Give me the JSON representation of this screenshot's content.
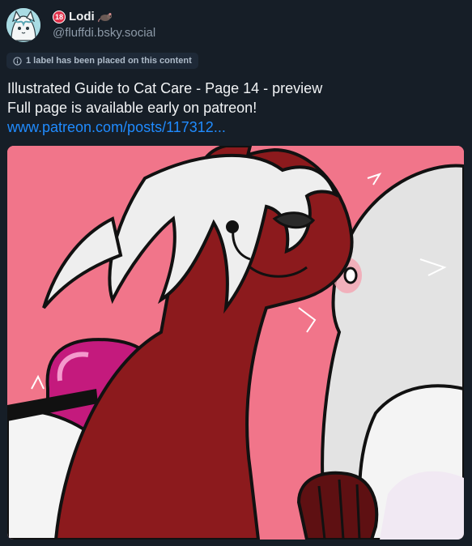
{
  "author": {
    "display_name": "Lodi",
    "handle": "@fluffdi.bsky.social",
    "badge_text": "18",
    "name_emoji_icon": "rat-icon",
    "avatar_icon": "cat-character-avatar"
  },
  "moderation": {
    "label_text": "1 label has been placed on this content",
    "icon": "info-circle-icon"
  },
  "post": {
    "lines": [
      "Illustrated Guide to Cat Care - Page 14 - preview",
      "Full page is available early on patreon!"
    ],
    "link_text": "www.patreon.com/posts/117312..."
  },
  "colors": {
    "background": "#161e27",
    "link": "#208bfe",
    "muted_text": "#8d9aa8",
    "pill_background": "#1e2937",
    "badge_red": "#e0324b",
    "image_pink": "#f06f85",
    "character_red": "#8c1a1d"
  }
}
